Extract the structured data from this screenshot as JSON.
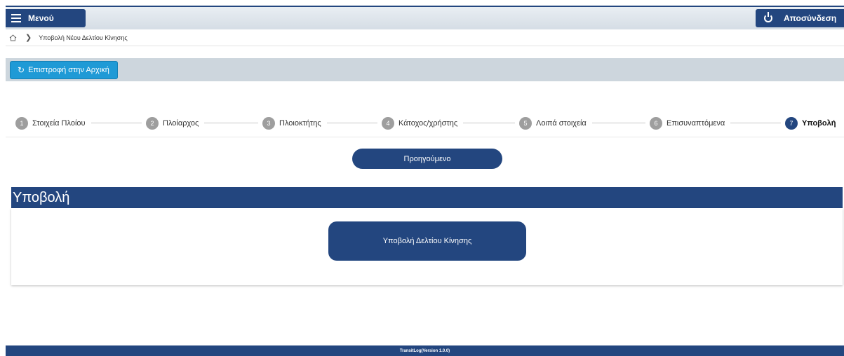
{
  "header": {
    "menu_label": "Μενού",
    "logout_label": "Αποσύνδεση"
  },
  "breadcrumb": {
    "current": "Υποβολή Νέου Δελτίου Κίνησης"
  },
  "actions": {
    "back_home_label": "Επιστροφή στην Αρχική"
  },
  "stepper": {
    "steps": [
      {
        "num": "1",
        "label": "Στοιχεία Πλοίου"
      },
      {
        "num": "2",
        "label": "Πλοίαρχος"
      },
      {
        "num": "3",
        "label": "Πλοιοκτήτης"
      },
      {
        "num": "4",
        "label": "Κάτοχος/χρήστης"
      },
      {
        "num": "5",
        "label": "Λοιπά στοιχεία"
      },
      {
        "num": "6",
        "label": "Επισυναπτόμενα"
      },
      {
        "num": "7",
        "label": "Υποβολή"
      }
    ],
    "active_step": 7
  },
  "navigation": {
    "previous_label": "Προηγούμενο"
  },
  "section": {
    "title": "Υποβολή",
    "submit_label": "Υποβολή Δελτίου Κίνησης"
  },
  "footer": {
    "text": "TransitLog(Version 1.0.0)"
  },
  "colors": {
    "primary": "#23467f",
    "accent": "#1f9ad6",
    "step_inactive": "#9e9e9e"
  }
}
